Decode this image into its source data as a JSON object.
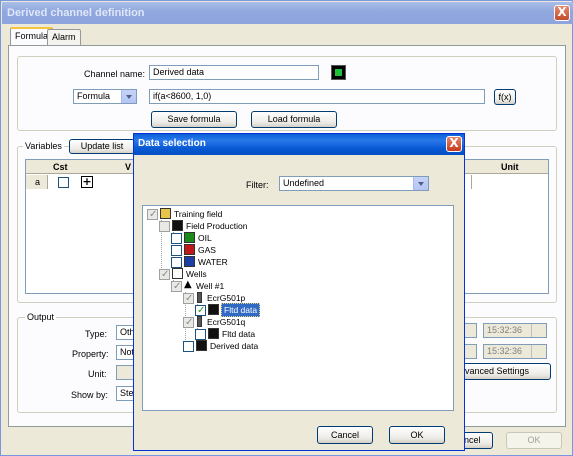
{
  "window": {
    "title": "Derived channel definition",
    "close_glyph": "X"
  },
  "tabs": [
    {
      "label": "Formula",
      "active": true
    },
    {
      "label": "Alarm",
      "active": false
    }
  ],
  "formula": {
    "channel_name_label": "Channel name:",
    "channel_name_value": "Derived data",
    "mode_value": "Formula",
    "expression": "if(a<8600, 1,0)",
    "fx_label": "f(x)",
    "save_label": "Save formula",
    "load_label": "Load formula"
  },
  "variables": {
    "group_label": "Variables",
    "update_label": "Update list",
    "columns": [
      "Cst",
      "V",
      "Unit"
    ],
    "rows": [
      {
        "name": "a",
        "cst": false
      }
    ]
  },
  "output": {
    "group_label": "Output",
    "type_label": "Type:",
    "type_value": "Oth",
    "property_label": "Property:",
    "property_value": "Not",
    "unit_label": "Unit:",
    "showby_label": "Show by:",
    "showby_value": "Step",
    "time1": "15:32:36",
    "time2": "15:32:36",
    "advanced_label": "vanced Settings"
  },
  "footer": {
    "cancel_label": "ncel",
    "ok_label": "OK"
  },
  "dialog": {
    "title": "Data selection",
    "close_glyph": "X",
    "filter_label": "Filter:",
    "filter_value": "Undefined",
    "tree": {
      "root": "Training field",
      "field_production": "Field Production",
      "oil": "OIL",
      "gas": "GAS",
      "water": "WATER",
      "wells": "Wells",
      "well1": "Well #1",
      "ecr501p": "EcrG501p",
      "fltd1": "Fltd data",
      "ecr501q": "EcrG501q",
      "fltd2": "Fltd data",
      "derived": "Derived data"
    },
    "cancel_label": "Cancel",
    "ok_label": "OK"
  },
  "colors": {
    "accent": "#0054e3",
    "selection": "#316ac5",
    "oil_icon": "#1a8a1a",
    "gas_icon": "#c01818",
    "water_icon": "#1c3fa6"
  }
}
